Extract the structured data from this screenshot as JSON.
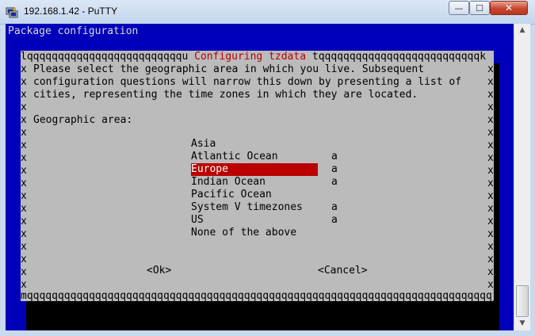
{
  "window": {
    "title": "192.168.1.42 - PuTTY",
    "icon": "putty-icon",
    "controls": {
      "minimize": "—",
      "maximize": "☐",
      "close": "✕"
    }
  },
  "terminal": {
    "header": "Package configuration",
    "dialog": {
      "title": "Configuring tzdata",
      "frame_top_left": "lqqqqqqqqqqqqqqqqqqqqqqqqqu ",
      "frame_top_right": " tqqqqqqqqqqqqqqqqqqqqqqqqqqk",
      "frame_bottom": "mqqqqqqqqqqqqqqqqqqqqqqqqqqqqqqqqqqqqqqqqqqqqqqqqqqqqqqqqqqqqqqqqqqqqqqqqqqqj",
      "border_char": "x",
      "description": [
        "Please select the geographic area in which you live. Subsequent",
        "configuration questions will narrow this down by presenting a list of",
        "cities, representing the time zones in which they are located."
      ],
      "prompt": "Geographic area:",
      "options": [
        {
          "label": "Asia",
          "more": ""
        },
        {
          "label": "Atlantic Ocean",
          "more": "a"
        },
        {
          "label": "Europe",
          "more": "a",
          "selected": true
        },
        {
          "label": "Indian Ocean",
          "more": "a"
        },
        {
          "label": "Pacific Ocean",
          "more": ""
        },
        {
          "label": "System V timezones",
          "more": "a"
        },
        {
          "label": "US",
          "more": "a"
        },
        {
          "label": "None of the above",
          "more": ""
        }
      ],
      "ok_button": "<Ok>",
      "cancel_button": "<Cancel>"
    }
  },
  "colors": {
    "terminal_bg": "#0000bb",
    "dialog_bg": "#bbbbbb",
    "highlight": "#bb0000"
  },
  "scrollbar": {
    "up": "▲",
    "down": "▼"
  }
}
